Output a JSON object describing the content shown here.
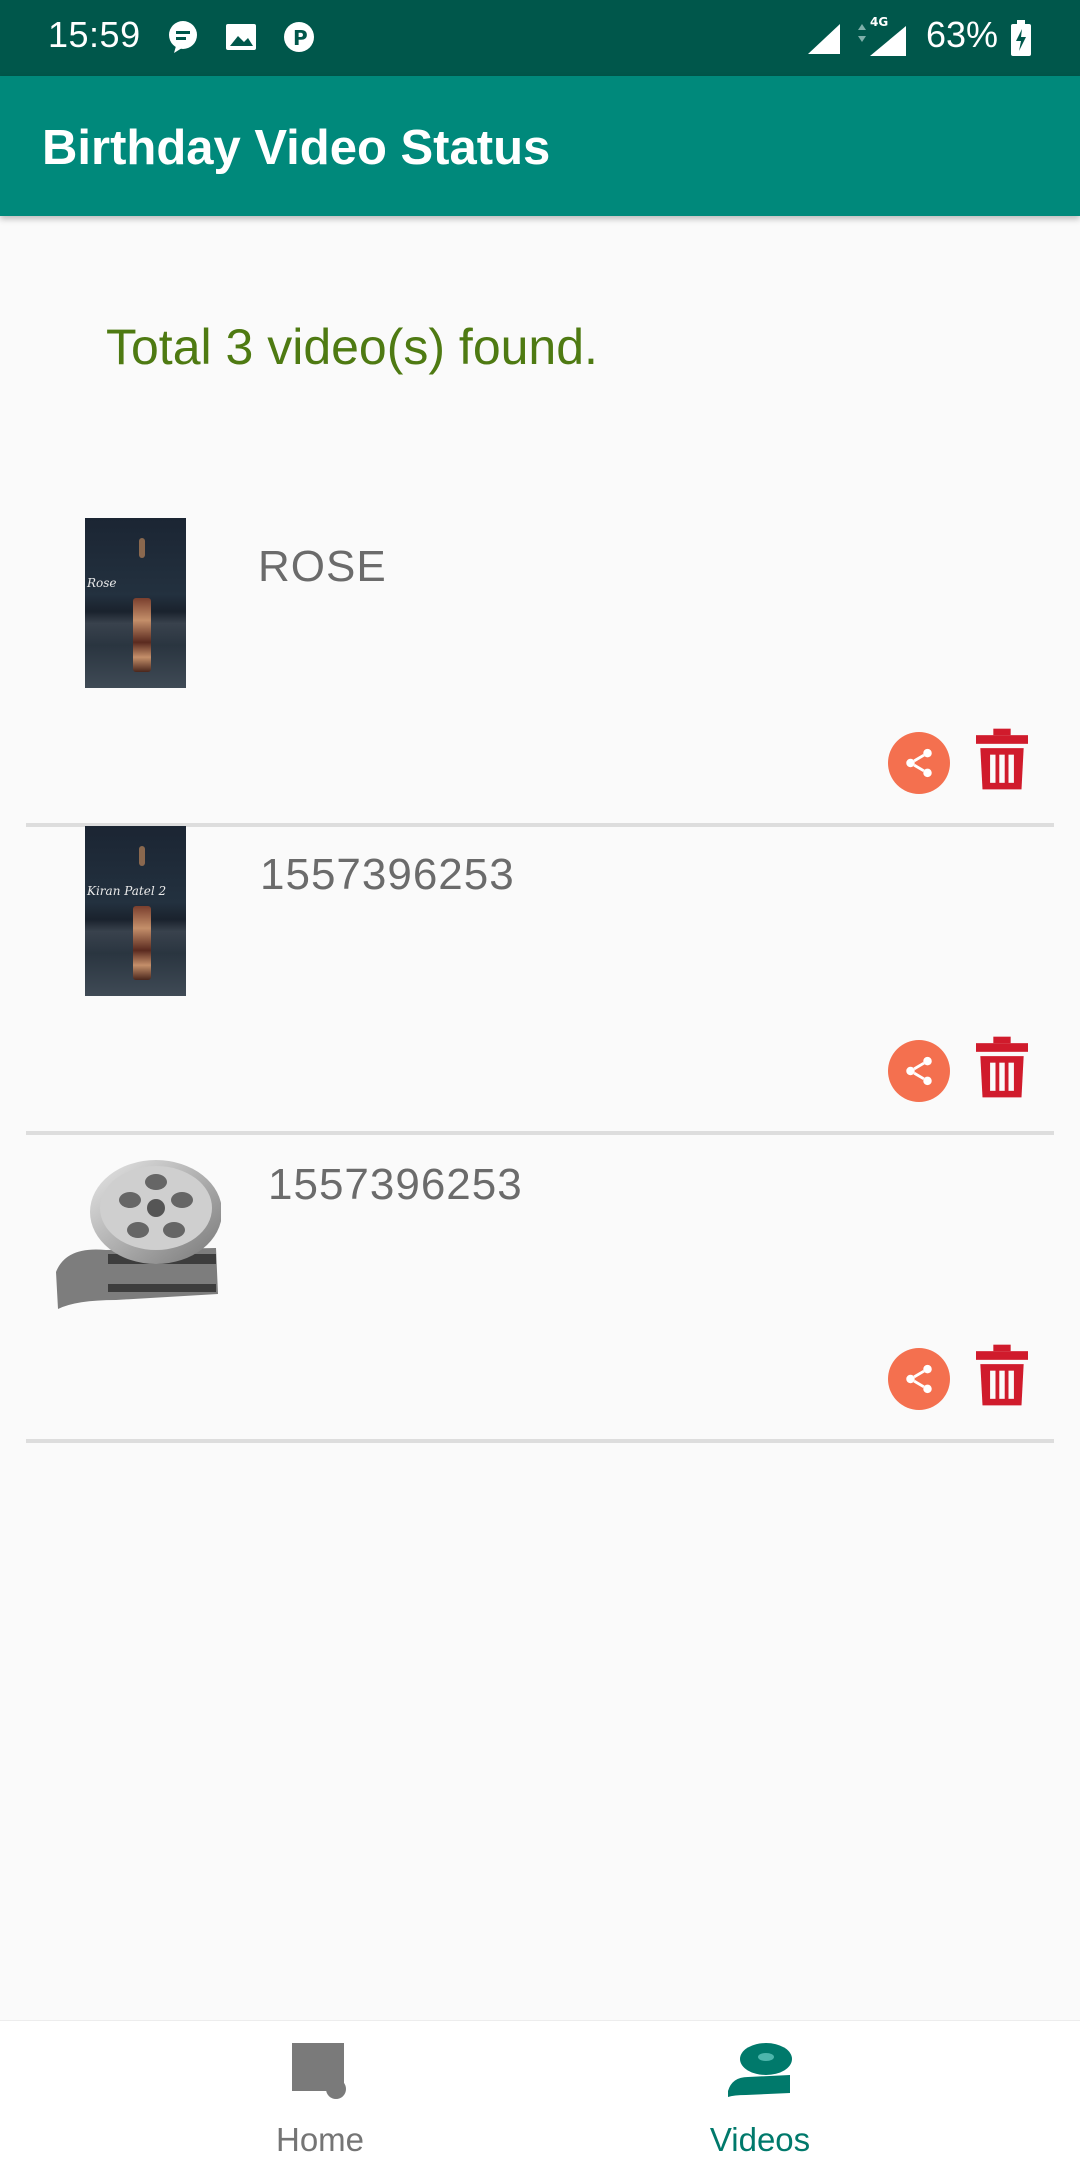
{
  "status_bar": {
    "time": "15:59",
    "battery": "63%",
    "network": "4G"
  },
  "app_bar": {
    "title": "Birthday Video Status"
  },
  "content": {
    "summary": "Total 3 video(s) found.",
    "items": [
      {
        "title": "ROSE",
        "thumbnail_caption": "Rose"
      },
      {
        "title": "1557396253",
        "thumbnail_caption": "Kiran Patel 2"
      },
      {
        "title": "1557396253"
      }
    ]
  },
  "bottom_nav": {
    "home_label": "Home",
    "videos_label": "Videos"
  },
  "colors": {
    "status_bar": "#00574b",
    "app_bar": "#00897b",
    "summary_text": "#4e7a12",
    "share": "#f4704f",
    "delete": "#d01b2c",
    "nav_active": "#00796b"
  }
}
